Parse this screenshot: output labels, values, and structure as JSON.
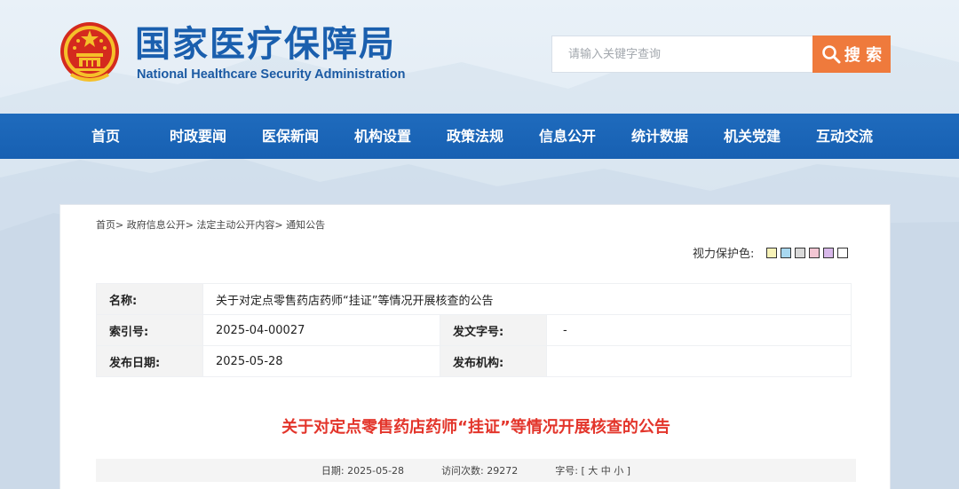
{
  "header": {
    "title": "国家医疗保障局",
    "subtitle": "National Healthcare Security Administration",
    "search_placeholder": "请输入关键字查询",
    "search_button": "搜 索"
  },
  "nav": {
    "items": [
      "首页",
      "时政要闻",
      "医保新闻",
      "机构设置",
      "政策法规",
      "信息公开",
      "统计数据",
      "机关党建",
      "互动交流"
    ]
  },
  "breadcrumb": [
    "首页>",
    "政府信息公开>",
    "法定主动公开内容>",
    "通知公告"
  ],
  "eye_care": {
    "label": "视力保护色:",
    "swatches": [
      "#f8f3b8",
      "#a8d8f0",
      "#d9d9d9",
      "#f3c6d3",
      "#d8b8ea",
      "#ffffff"
    ]
  },
  "info": {
    "name_label": "名称:",
    "name_value": "关于对定点零售药店药师“挂证”等情况开展核查的公告",
    "index_label": "索引号:",
    "index_value": "2025-04-00027",
    "docno_label": "发文字号:",
    "docno_value": "-",
    "date_label": "发布日期:",
    "date_value": "2025-05-28",
    "org_label": "发布机构:",
    "org_value": ""
  },
  "doc_title": "关于对定点零售药店药师“挂证”等情况开展核查的公告",
  "meta": {
    "date_label": "日期:",
    "date": "2025-05-28",
    "visits_label": "访问次数:",
    "visits": "29272",
    "font_label": "字号:",
    "font_open": "[",
    "font_large": "大",
    "font_medium": "中",
    "font_small": "小",
    "font_close": "]"
  },
  "colors": {
    "brand_blue": "#1a5fae",
    "nav_blue": "#1f6bbd",
    "search_orange": "#ef7a3c",
    "title_red": "#e3352b"
  }
}
